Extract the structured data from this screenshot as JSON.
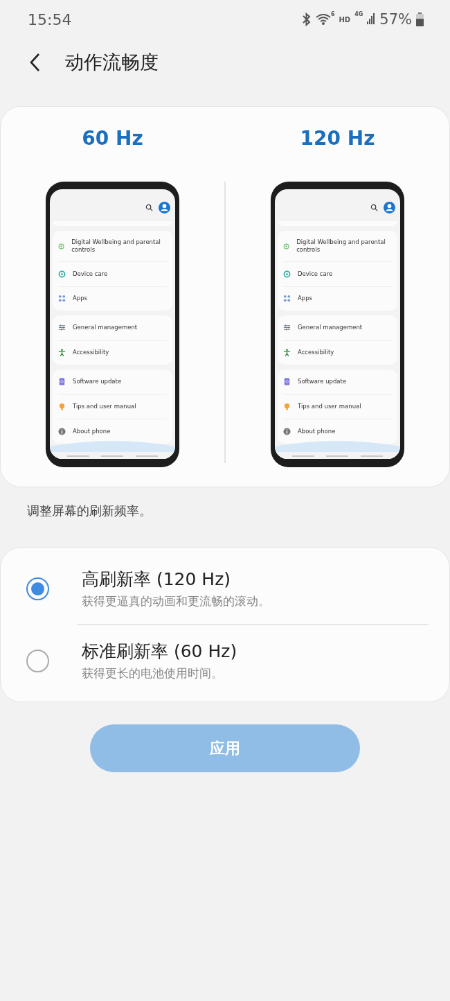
{
  "status_bar": {
    "time": "15:54",
    "wifi_badge": "6",
    "hd": "HD",
    "network": "4G",
    "battery": "57%"
  },
  "header": {
    "title": "动作流畅度"
  },
  "preview": {
    "columns": [
      {
        "label": "60 Hz",
        "groups": [
          [
            {
              "kind": "wellbeing",
              "label": "Digital Wellbeing and parental controls"
            },
            {
              "kind": "care",
              "label": "Device care"
            },
            {
              "kind": "apps",
              "label": "Apps"
            }
          ],
          [
            {
              "kind": "sliders",
              "label": "General management"
            },
            {
              "kind": "person",
              "label": "Accessibility"
            }
          ],
          [
            {
              "kind": "update",
              "label": "Software update"
            },
            {
              "kind": "bulb",
              "label": "Tips and user manual"
            },
            {
              "kind": "info",
              "label": "About phone"
            }
          ]
        ]
      },
      {
        "label": "120 Hz",
        "groups": [
          [
            {
              "kind": "wellbeing",
              "label": "Digital Wellbeing and parental controls"
            },
            {
              "kind": "care",
              "label": "Device care"
            },
            {
              "kind": "apps",
              "label": "Apps"
            }
          ],
          [
            {
              "kind": "sliders",
              "label": "General management"
            },
            {
              "kind": "person",
              "label": "Accessibility"
            }
          ],
          [
            {
              "kind": "update",
              "label": "Software update"
            },
            {
              "kind": "bulb",
              "label": "Tips and user manual"
            },
            {
              "kind": "info",
              "label": "About phone"
            }
          ]
        ]
      }
    ]
  },
  "description": "调整屏幕的刷新频率。",
  "options": [
    {
      "title": "高刷新率 (120 Hz)",
      "subtitle": "获得更逼真的动画和更流畅的滚动。",
      "selected": true
    },
    {
      "title": "标准刷新率 (60 Hz)",
      "subtitle": "获得更长的电池使用时间。",
      "selected": false
    }
  ],
  "apply_button": {
    "label": "应用",
    "disabled": true
  }
}
